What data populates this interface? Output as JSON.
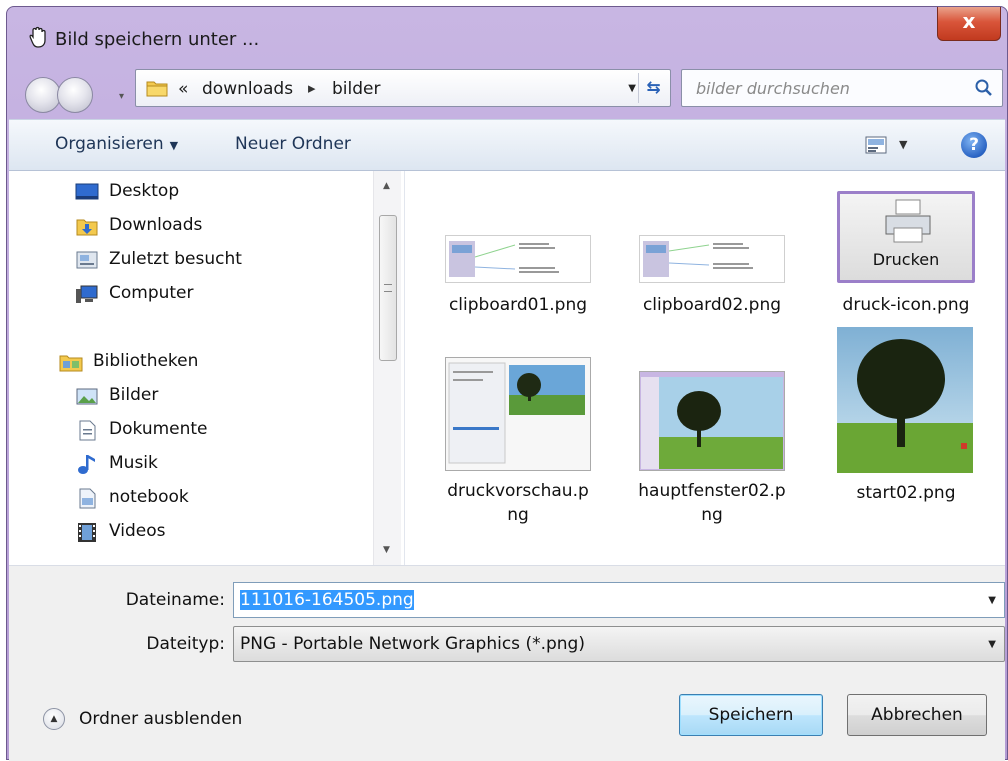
{
  "window": {
    "title": "Bild speichern unter ...",
    "close_symbol": "x"
  },
  "address": {
    "chevrons": "«",
    "crumbs": [
      "downloads",
      "bilder"
    ],
    "separator": "▸"
  },
  "search": {
    "placeholder": "bilder durchsuchen"
  },
  "toolbar": {
    "organize_label": "Organisieren",
    "new_folder_label": "Neuer Ordner",
    "help_symbol": "?"
  },
  "sidebar": {
    "items": [
      {
        "label": "Desktop",
        "icon": "desktop-icon"
      },
      {
        "label": "Downloads",
        "icon": "downloads-folder-icon"
      },
      {
        "label": "Zuletzt besucht",
        "icon": "recent-places-icon"
      },
      {
        "label": "Computer",
        "icon": "computer-icon"
      },
      {
        "label": "Bibliotheken",
        "icon": "libraries-icon"
      },
      {
        "label": "Bilder",
        "icon": "pictures-icon"
      },
      {
        "label": "Dokumente",
        "icon": "documents-icon"
      },
      {
        "label": "Musik",
        "icon": "music-icon"
      },
      {
        "label": "notebook",
        "icon": "notebook-icon"
      },
      {
        "label": "Videos",
        "icon": "videos-icon"
      }
    ]
  },
  "files": [
    {
      "name_line1": "clipboard01.png",
      "name_line2": ""
    },
    {
      "name_line1": "clipboard02.png",
      "name_line2": ""
    },
    {
      "name_line1": "druck-icon.png",
      "name_line2": "",
      "thumb_text": "Drucken"
    },
    {
      "name_line1": "druckvorschau.p",
      "name_line2": "ng"
    },
    {
      "name_line1": "hauptfenster02.p",
      "name_line2": "ng"
    },
    {
      "name_line1": "start02.png",
      "name_line2": ""
    }
  ],
  "form": {
    "filename_label": "Dateiname:",
    "filename_value": "111016-164505.png",
    "filetype_label": "Dateityp:",
    "filetype_value": "PNG - Portable Network Graphics (*.png)"
  },
  "footer": {
    "hide_folders_label": "Ordner ausblenden",
    "save_label": "Speichern",
    "cancel_label": "Abbrechen"
  },
  "colors": {
    "frame": "#c3b1e0",
    "selection": "#3399ff",
    "toolbar_text": "#1e3557"
  }
}
